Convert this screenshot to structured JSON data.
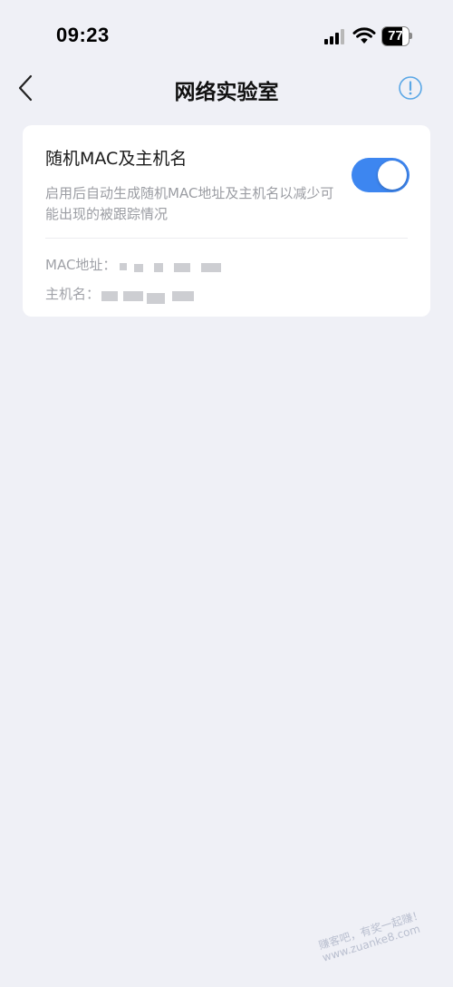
{
  "status_bar": {
    "time": "09:23",
    "battery_level": "77",
    "battery_fraction": 0.77
  },
  "nav": {
    "title": "网络实验室",
    "back_icon": "chevron-left-icon",
    "info_icon": "info-circle-icon",
    "accent_color": "#5aa7e6"
  },
  "setting": {
    "title": "随机MAC及主机名",
    "description": "启用后自动生成随机MAC地址及主机名以减少可能出现的被跟踪情况",
    "toggle_on": true,
    "toggle_color": "#3d86f0",
    "mac_label": "MAC地址：",
    "hostname_label": "主机名："
  },
  "watermark": {
    "line1": "赚客吧，有奖一起赚！",
    "line2": "www.zuanke8.com"
  }
}
